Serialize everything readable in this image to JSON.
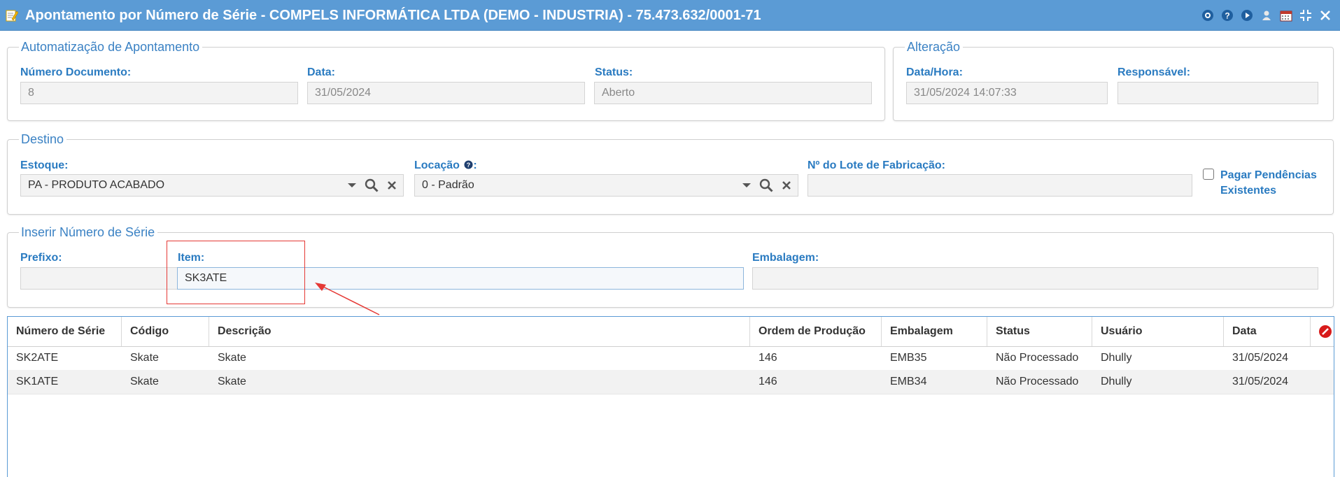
{
  "window": {
    "title": "Apontamento por Número de Série - COMPELS INFORMÁTICA LTDA (DEMO - INDUSTRIA) - 75.473.632/0001-71",
    "icons": [
      "record-icon",
      "help-icon",
      "play-icon",
      "user-icon",
      "calendar-icon",
      "collapse-icon",
      "close-icon"
    ]
  },
  "automatizacao": {
    "legend": "Automatização de Apontamento",
    "numero_documento_label": "Número Documento:",
    "numero_documento_value": "8",
    "data_label": "Data:",
    "data_value": "31/05/2024",
    "status_label": "Status:",
    "status_value": "Aberto"
  },
  "alteracao": {
    "legend": "Alteração",
    "data_hora_label": "Data/Hora:",
    "data_hora_value": "31/05/2024 14:07:33",
    "responsavel_label": "Responsável:",
    "responsavel_value": ""
  },
  "destino": {
    "legend": "Destino",
    "estoque_label": "Estoque:",
    "estoque_value": "PA - PRODUTO ACABADO",
    "locacao_label": "Locação",
    "locacao_suffix": ":",
    "locacao_value": "0 - Padrão",
    "lote_label": "Nº do Lote de Fabricação:",
    "lote_value": "",
    "pagar_line1": "Pagar Pendências",
    "pagar_line2": "Existentes",
    "pagar_checked": false
  },
  "inserir": {
    "legend": "Inserir Número de Série",
    "prefixo_label": "Prefixo:",
    "prefixo_value": "",
    "item_label": "Item:",
    "item_value": "SK3ATE",
    "embalagem_label": "Embalagem:",
    "embalagem_value": ""
  },
  "table": {
    "columns": [
      "Número de Série",
      "Código",
      "Descrição",
      "Ordem de Produção",
      "Embalagem",
      "Status",
      "Usuário",
      "Data"
    ],
    "rows": [
      [
        "SK2ATE",
        "Skate",
        "Skate",
        "146",
        "EMB35",
        "Não Processado",
        "Dhully",
        "31/05/2024"
      ],
      [
        "SK1ATE",
        "Skate",
        "Skate",
        "146",
        "EMB34",
        "Não Processado",
        "Dhully",
        "31/05/2024"
      ]
    ]
  },
  "colors": {
    "titlebar": "#5b9bd5",
    "label": "#2a7bc1",
    "annotation": "#e53935"
  }
}
